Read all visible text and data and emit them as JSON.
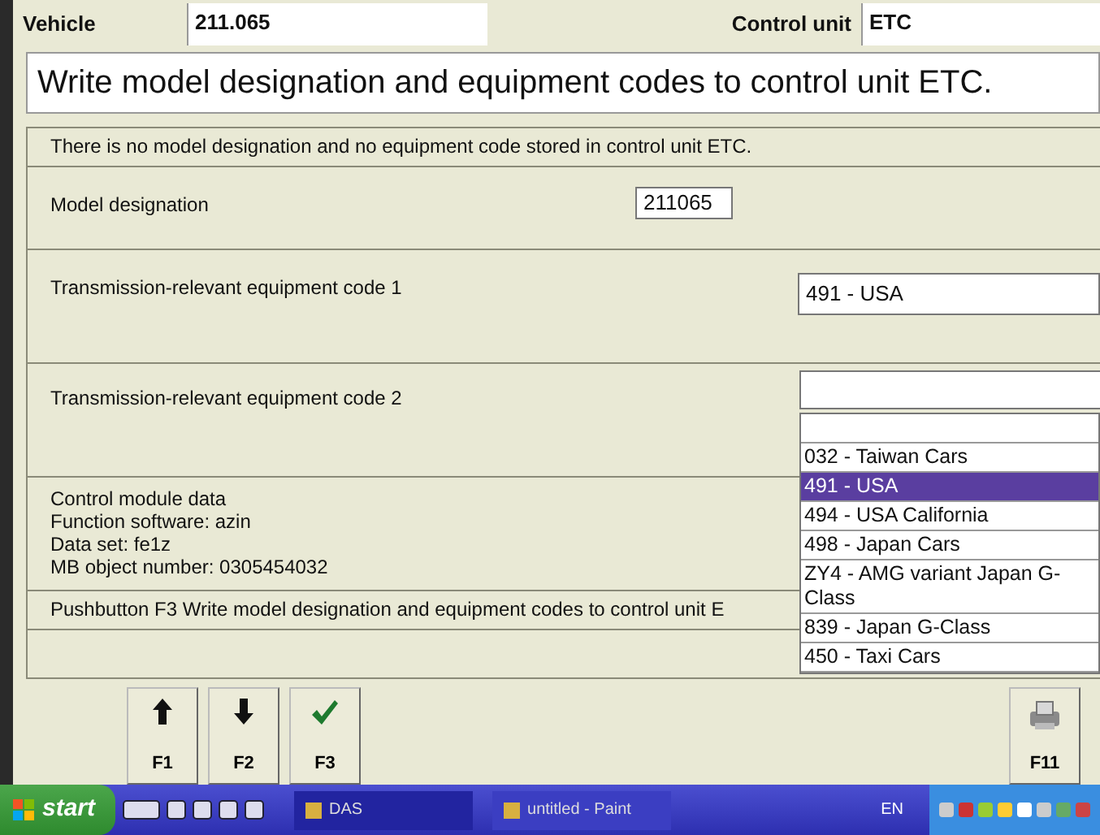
{
  "header": {
    "vehicle_label": "Vehicle",
    "vehicle_value": "211.065",
    "control_unit_label": "Control unit",
    "control_unit_value": "ETC"
  },
  "title": "Write model designation and equipment codes to control unit ETC.",
  "notice": "There is no model designation and no equipment code stored in control unit ETC.",
  "model": {
    "label": "Model designation",
    "value": "211065"
  },
  "code1": {
    "label": "Transmission-relevant equipment code 1",
    "value": "491 - USA"
  },
  "code2": {
    "label": "Transmission-relevant equipment code 2",
    "expanded": true,
    "options": [
      {
        "selected": false
      },
      {
        "label": "032 - Taiwan Cars",
        "selected": false
      },
      {
        "label": "491 - USA",
        "selected": true
      },
      {
        "label": "494 - USA California",
        "selected": false
      },
      {
        "label": "498 - Japan Cars",
        "selected": false
      },
      {
        "label": "ZY4 - AMG variant Japan G-Class",
        "selected": false
      },
      {
        "label": "839 - Japan G-Class",
        "selected": false
      },
      {
        "label": "450 - Taxi Cars",
        "selected": false
      }
    ]
  },
  "module_data": [
    "Control module data",
    "Function software:  azin",
    "Data set:  fe1z",
    "MB object number:  0305454032"
  ],
  "pushbutton_hint": "Pushbutton F3  Write model designation and equipment codes to control unit E",
  "buttons": [
    {
      "kind": "up",
      "label": "F1"
    },
    {
      "kind": "down",
      "label": "F2"
    },
    {
      "kind": "check",
      "label": "F3"
    },
    {
      "kind": "print",
      "label": "F11"
    }
  ],
  "taskbar": {
    "start": "start",
    "tasks": [
      {
        "label": "DAS",
        "selected": true
      },
      {
        "label": "untitled - Paint",
        "selected": false
      }
    ],
    "language": "EN"
  }
}
